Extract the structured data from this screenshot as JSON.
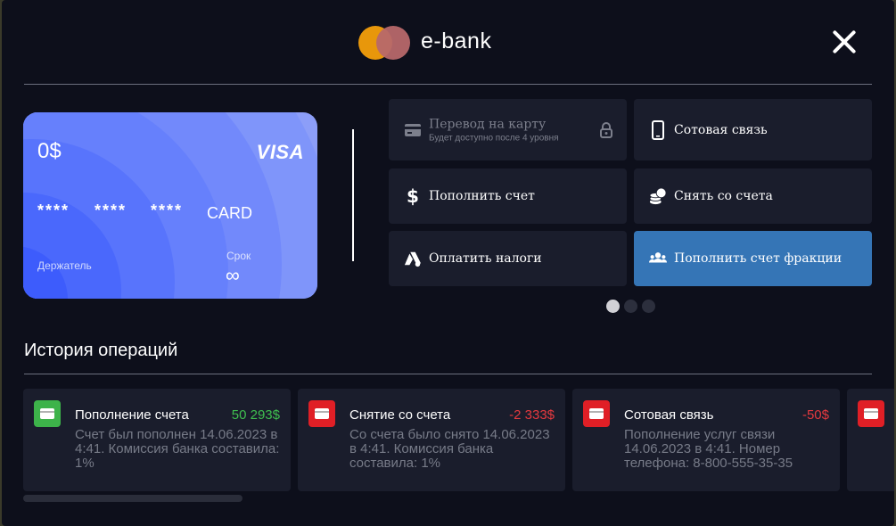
{
  "header": {
    "brand": "e-bank"
  },
  "card": {
    "balance": "0$",
    "network": "VISA",
    "number_groups": [
      "****",
      "****",
      "****"
    ],
    "number_last": "CARD",
    "holder_label": "Держатель",
    "term_label": "Срок",
    "term_value": "∞"
  },
  "services": [
    {
      "label": "Перевод на карту",
      "sublabel": "Будет доступно после 4 уровня",
      "icon": "card-icon",
      "locked": true
    },
    {
      "label": "Сотовая связь",
      "icon": "phone-icon"
    },
    {
      "label": "Пополнить счет",
      "icon": "dollar-icon"
    },
    {
      "label": "Снять со счета",
      "icon": "coins-icon"
    },
    {
      "label": "Оплатить налоги",
      "icon": "tax-icon"
    },
    {
      "label": "Пополнить счет фракции",
      "icon": "users-icon",
      "active": true
    }
  ],
  "pagination": {
    "pages": 3,
    "current": 1
  },
  "history": {
    "title": "История операций",
    "items": [
      {
        "title": "Пополнение счета",
        "amount": "50 293$",
        "amount_color": "#3fbf4f",
        "badge_color": "#3db34a",
        "description": "Счет был пополнен 14.06.2023 в 4:41. Комиссия банка составила: 1%"
      },
      {
        "title": "Снятие со счета",
        "amount": "-2 333$",
        "amount_color": "#e5393f",
        "badge_color": "#e01f26",
        "description": "Со счета было снято 14.06.2023 в 4:41. Комиссия банка составила: 1%"
      },
      {
        "title": "Сотовая связь",
        "amount": "-50$",
        "amount_color": "#e5393f",
        "badge_color": "#e01f26",
        "description": "Пополнение услуг связи 14.06.2023 в 4:41. Номер телефона: 8-800-555-35-35"
      }
    ]
  },
  "colors": {
    "accent": "#3575b6",
    "background": "#0d0f1b",
    "tile": "#1a1d2c"
  }
}
